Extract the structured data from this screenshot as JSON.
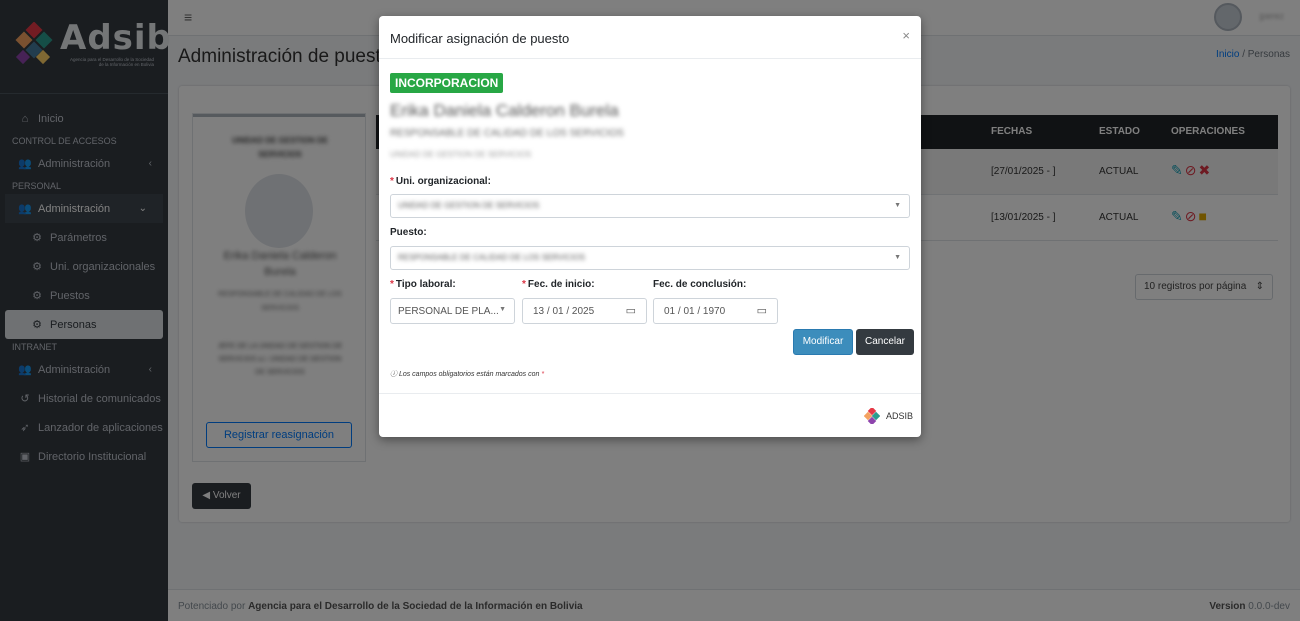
{
  "brand": {
    "name": "Adsib",
    "subtitle": "Agencia para el Desarrollo de la Sociedad de la Información en Bolivia"
  },
  "sidebar": {
    "items": [
      {
        "type": "item",
        "label": "Inicio",
        "icon": "home-icon"
      },
      {
        "type": "header",
        "label": "CONTROL DE ACCESOS"
      },
      {
        "type": "item",
        "label": "Administración",
        "icon": "users-cog-icon",
        "arrow": "‹"
      },
      {
        "type": "header",
        "label": "PERSONAL"
      },
      {
        "type": "item",
        "label": "Administración",
        "icon": "users-cog-icon",
        "arrow": "⌄",
        "active_parent": true
      },
      {
        "type": "sub",
        "label": "Parámetros",
        "icon": "gear-icon"
      },
      {
        "type": "sub",
        "label": "Uni. organizacionales",
        "icon": "gear-icon"
      },
      {
        "type": "sub",
        "label": "Puestos",
        "icon": "gear-icon"
      },
      {
        "type": "sub",
        "label": "Personas",
        "icon": "gear-icon",
        "active": true
      },
      {
        "type": "header",
        "label": "INTRANET"
      },
      {
        "type": "item",
        "label": "Administración",
        "icon": "users-cog-icon",
        "arrow": "‹"
      },
      {
        "type": "item",
        "label": "Historial de comunicados",
        "icon": "history-icon"
      },
      {
        "type": "item",
        "label": "Lanzador de aplicaciones",
        "icon": "rocket-icon"
      },
      {
        "type": "item",
        "label": "Directorio Institucional",
        "icon": "address-book-icon"
      }
    ]
  },
  "topbar": {
    "user_name": "jperez"
  },
  "page": {
    "title": "Administración de puestos",
    "breadcrumb_home": "Inicio",
    "breadcrumb_sep": "/",
    "breadcrumb_current": "Personas"
  },
  "profile": {
    "unit": "UNIDAD DE GESTION DE SERVICIOS",
    "name": "Erika Daniela Calderon Burela",
    "role": "RESPONSABLE DE CALIDAD DE LOS SERVICIOS",
    "department": "JEFE DE LA UNIDAD DE GESTION DE SERVICIOS a.i. UNIDAD DE GESTION DE SERVICIOS",
    "reassign_label": "Registrar reasignación"
  },
  "table": {
    "headers": {
      "fechas": "FECHAS",
      "estado": "ESTADO",
      "operaciones": "OPERACIONES"
    },
    "rows": [
      {
        "fechas": "[27/01/2025 - ]",
        "estado": "ACTUAL",
        "last_op": "remove-user-icon"
      },
      {
        "fechas": "[13/01/2025 - ]",
        "estado": "ACTUAL",
        "last_op": "lock-icon"
      }
    ]
  },
  "per_page": "10 registros por página",
  "back_label": "Volver",
  "footer": {
    "left_prefix": "Potenciado por",
    "left_org": "Agencia para el Desarrollo de la Sociedad de la Información en Bolivia",
    "right_label": "Version",
    "right_value": "0.0.0-dev"
  },
  "modal": {
    "title": "Modificar asignación de puesto",
    "close": "×",
    "badge": "INCORPORACION",
    "person_name": "Erika Daniela Calderon Burela",
    "person_role": "RESPONSABLE DE CALIDAD DE LOS SERVICIOS",
    "person_unit": "UNIDAD DE GESTION DE SERVICIOS",
    "uni_label": "Uni. organizacional:",
    "uni_value": "UNIDAD DE GESTION DE SERVICIOS",
    "puesto_label": "Puesto:",
    "puesto_value": "RESPONSABLE DE CALIDAD DE LOS SERVICIOS",
    "tipo_label": "Tipo laboral:",
    "tipo_value": "PERSONAL DE PLA...",
    "inicio_label": "Fec. de inicio:",
    "inicio_value": "13 / 01 / 2025",
    "conclusion_label": "Fec. de conclusión:",
    "conclusion_value": "01 / 01 / 1970",
    "modify_label": "Modificar",
    "cancel_label": "Cancelar",
    "required_note": "Los campos obligatorios están marcados con",
    "required_mark": "*",
    "footer_brand": "ADSIB"
  }
}
